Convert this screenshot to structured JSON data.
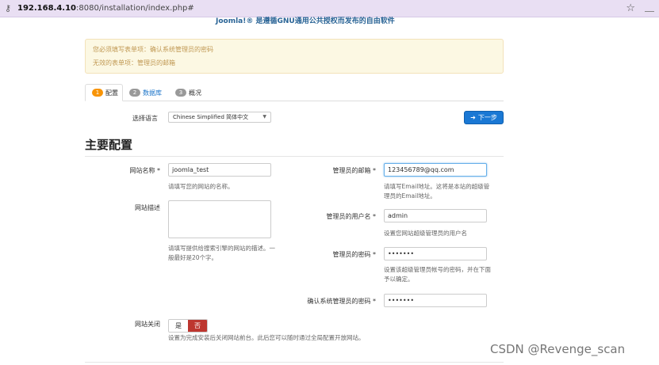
{
  "browser": {
    "url_host": "192.168.4.10",
    "url_rest": ":8080/installation/index.php#"
  },
  "header": {
    "text": "Joomla!® 是遵循GNU通用公共授权而发布的自由软件"
  },
  "alert": {
    "line1": "您必须填写表单项：确认系统管理员的密码",
    "line2": "无效的表单项：管理员的邮箱"
  },
  "tabs": [
    {
      "num": "1",
      "label": "配置"
    },
    {
      "num": "2",
      "label": "数据库"
    },
    {
      "num": "3",
      "label": "概况"
    }
  ],
  "language": {
    "label": "选择语言",
    "value": "Chinese Simplified 简体中文"
  },
  "next_button": "下一步",
  "section_title": "主要配置",
  "form": {
    "site_name": {
      "label": "网站名称 *",
      "value": "joomla_test",
      "help": "请填写您的网站的名称。"
    },
    "site_desc": {
      "label": "网站描述",
      "help1": "请填写提供给搜索引擎的网站的描述。一",
      "help2": "般最好是20个字。"
    },
    "admin_email": {
      "label": "管理员的邮箱 *",
      "value": "123456789@qq.com",
      "help1": "请填写Email地址。这将是本站的超级管",
      "help2": "理员的Email地址。"
    },
    "admin_user": {
      "label": "管理员的用户名 *",
      "value": "admin",
      "help": "设置您网站超级管理员的用户名"
    },
    "admin_pass": {
      "label": "管理员的密码 *",
      "value": "•••••••",
      "help1": "设置该超级管理员帐号的密码，并在下面",
      "help2": "予以确定。"
    },
    "confirm_pass": {
      "label": "确认系统管理员的密码 *",
      "value": "•••••••"
    },
    "site_offline": {
      "label": "网站关闭",
      "yes": "是",
      "no": "否",
      "help": "设置为完成安装后关闭网站前台。此后您可以随时通过全局配置开放网站。"
    }
  },
  "watermark": "CSDN @Revenge_scan"
}
